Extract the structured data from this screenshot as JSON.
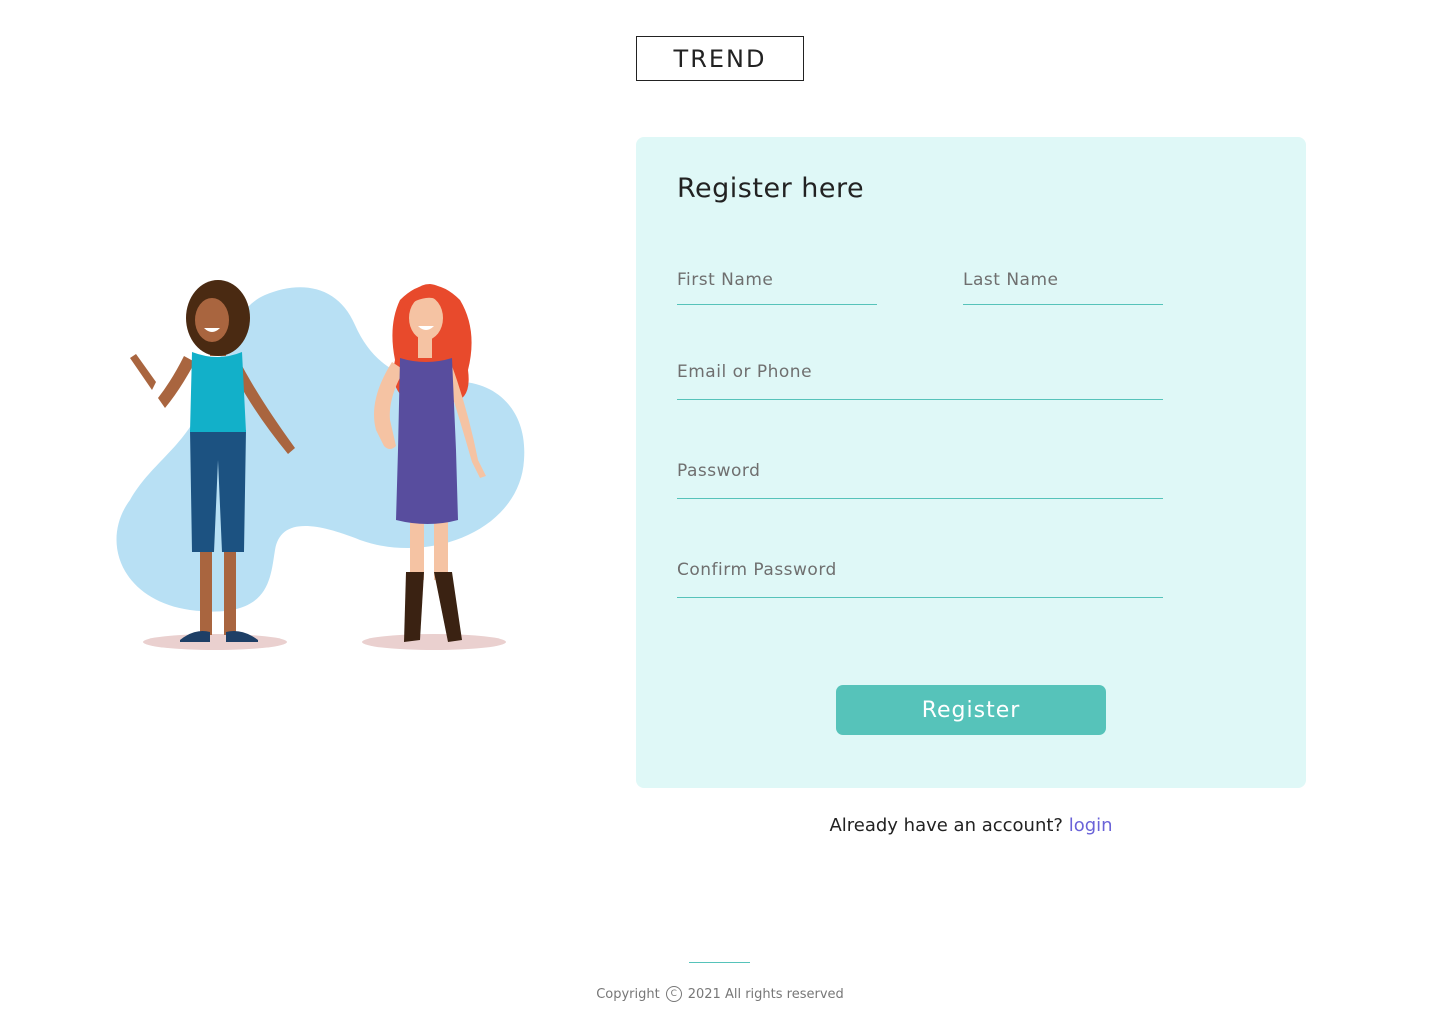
{
  "brand": {
    "logo_text": "TREND"
  },
  "form": {
    "title": "Register here",
    "fields": {
      "first_name": {
        "placeholder": "First Name",
        "value": ""
      },
      "last_name": {
        "placeholder": "Last Name",
        "value": ""
      },
      "email": {
        "placeholder": "Email or Phone",
        "value": ""
      },
      "password": {
        "placeholder": "Password",
        "value": ""
      },
      "confirm_password": {
        "placeholder": "Confirm Password",
        "value": ""
      }
    },
    "submit_label": "Register"
  },
  "login_prompt": {
    "text": "Already have an account? ",
    "link_label": "login"
  },
  "footer": {
    "copyright_label": "Copyright",
    "copyright_icon": "copyright-icon",
    "year_text": "2021 All rights reserved"
  },
  "colors": {
    "accent": "#56c3ba",
    "card_background": "#dff8f7",
    "link": "#6a63d8",
    "blob": "#b8e0f4"
  },
  "illustration": {
    "icon": "two-women-illustration"
  }
}
